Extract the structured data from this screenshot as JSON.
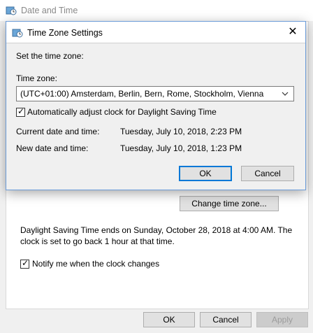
{
  "parent_window": {
    "title": "Date and Time",
    "change_tz_button": "Change time zone...",
    "dst_text_line1": "Daylight Saving Time ends on Sunday, October 28, 2018 at 4:00 AM. The",
    "dst_text_line2": "clock is set to go back 1 hour at that time.",
    "notify_label": "Notify me when the clock changes",
    "notify_checked": true,
    "ok_label": "OK",
    "cancel_label": "Cancel",
    "apply_label": "Apply"
  },
  "dialog": {
    "title": "Time Zone Settings",
    "close_glyph": "✕",
    "set_tz_label": "Set the time zone:",
    "tz_label": "Time zone:",
    "tz_value": "(UTC+01:00) Amsterdam, Berlin, Bern, Rome, Stockholm, Vienna",
    "dst_auto_label": "Automatically adjust clock for Daylight Saving Time",
    "dst_auto_checked": true,
    "current_label": "Current date and time:",
    "current_value": "Tuesday, July 10, 2018, 2:23 PM",
    "new_label": "New date and time:",
    "new_value": "Tuesday, July 10, 2018, 1:23 PM",
    "ok_label": "OK",
    "cancel_label": "Cancel"
  },
  "check_glyph": "✓",
  "dropdown_glyph": "⌄",
  "icons": {
    "app": "clock-globe-icon"
  },
  "colors": {
    "accent": "#0078d7",
    "dialog_border": "#6a9bd8"
  }
}
